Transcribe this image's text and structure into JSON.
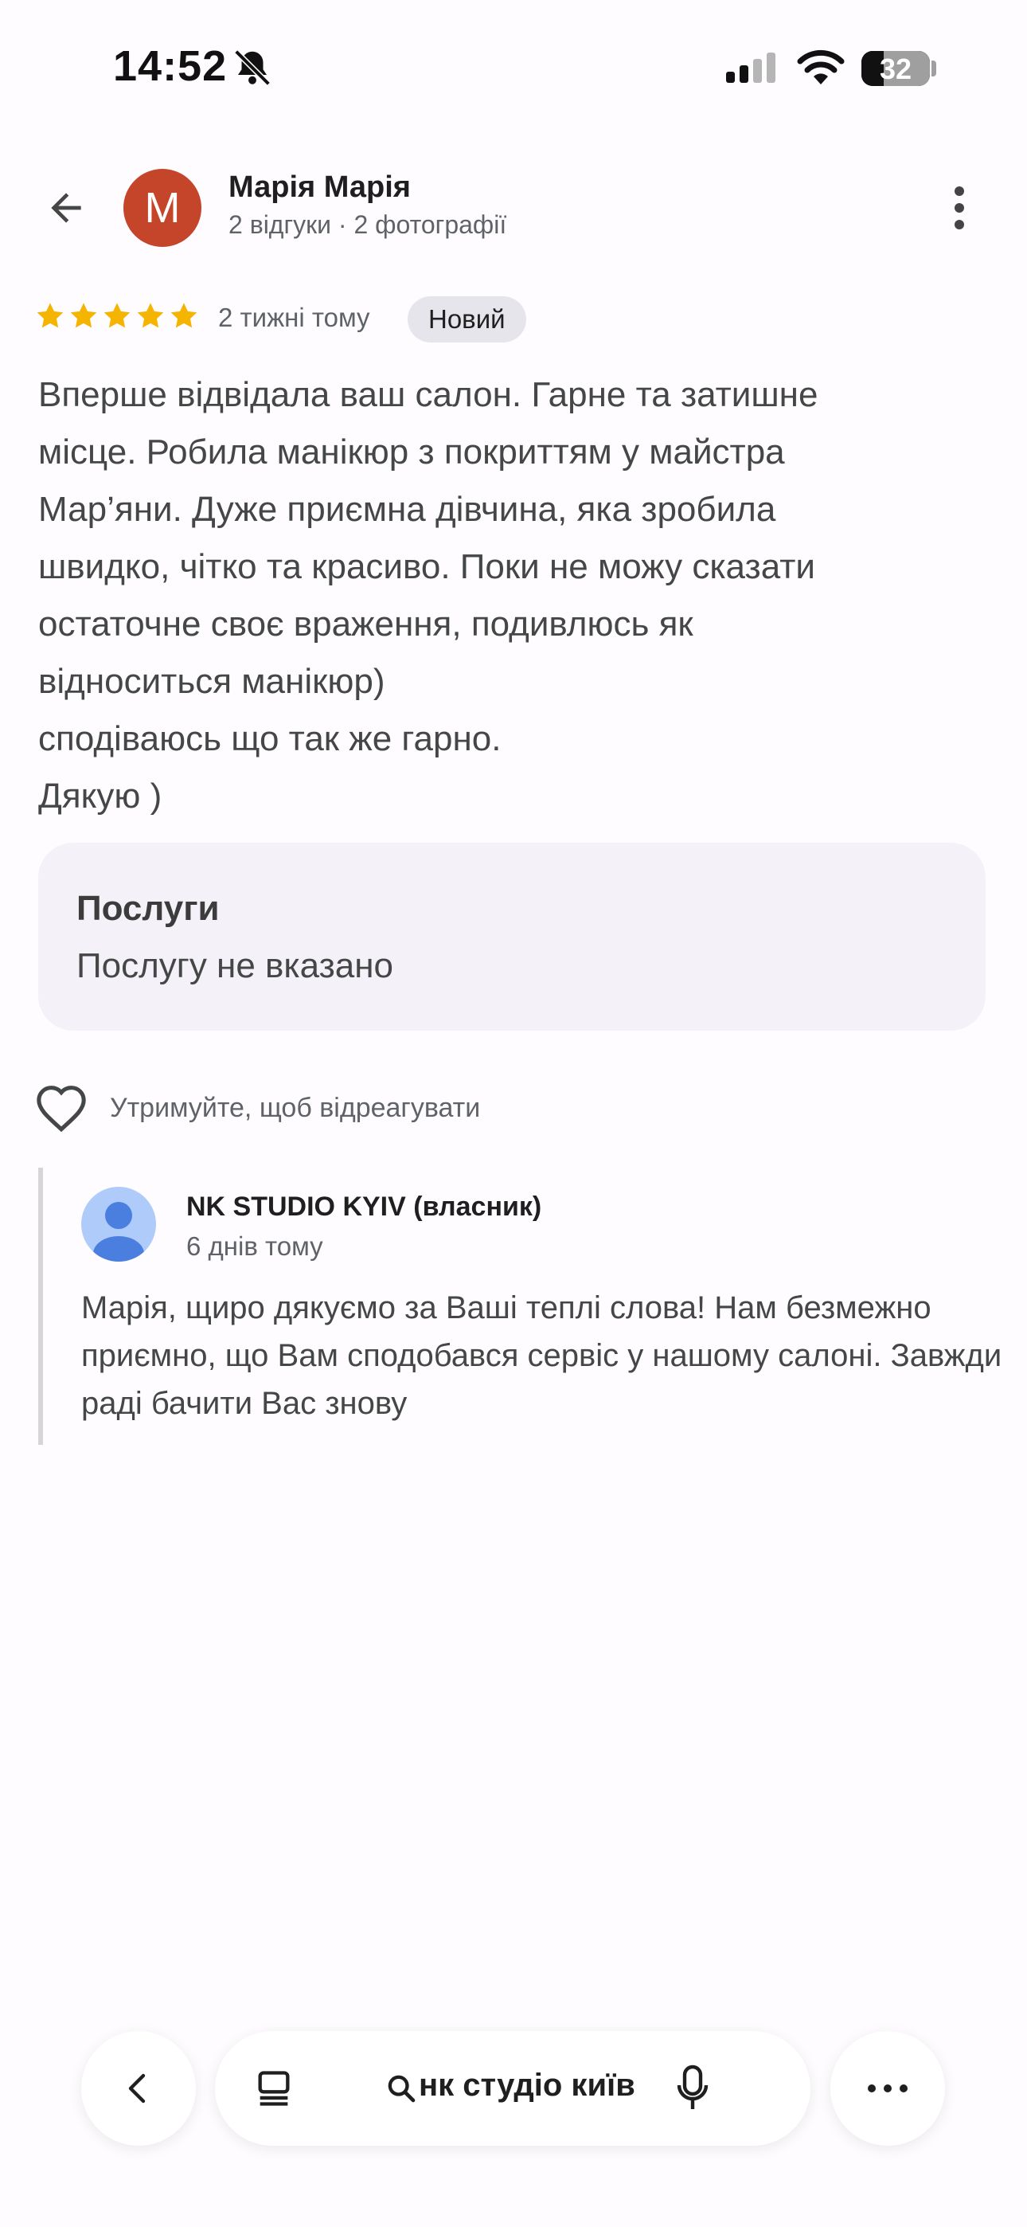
{
  "status_bar": {
    "time": "14:52",
    "battery_level": "32",
    "battery_fraction": 0.32,
    "icons": [
      "bell-off-icon",
      "signal-icon",
      "wifi-icon",
      "battery-icon"
    ]
  },
  "header": {
    "avatar_letter": "M",
    "avatar_color": "#c5452a",
    "author_name": "Марія Марія",
    "author_meta": "2 відгуки · 2 фотографії"
  },
  "review": {
    "rating": 5,
    "star_color": "#f4b400",
    "age": "2 тижні тому",
    "badge": "Новий",
    "text": "Вперше відвідала ваш салон. Гарне та затишне\nмісце. Робила манікюр з покриттям у майстра\nМар’яни. Дуже приємна дівчина, яка зробила\nшвидко, чітко та красиво. Поки не можу сказати\nостаточне своє враження, подивлюсь як\nвідноситься манікюр)\nсподіваюсь що так же гарно.\nДякую )"
  },
  "services": {
    "title": "Послуги",
    "value": "Послугу не вказано"
  },
  "reaction": {
    "hint": "Утримуйте, щоб відреагувати"
  },
  "owner_reply": {
    "name": "NK STUDIO KYIV (власник)",
    "age": "6 днів тому",
    "text": "Марія, щиро дякуємо за Ваші теплі слова! Нам безмежно приємно, що Вам сподобався сервіс у нашому салоні. Завжди раді бачити Вас знову"
  },
  "bottom_bar": {
    "search_query": "нк студіо київ"
  }
}
